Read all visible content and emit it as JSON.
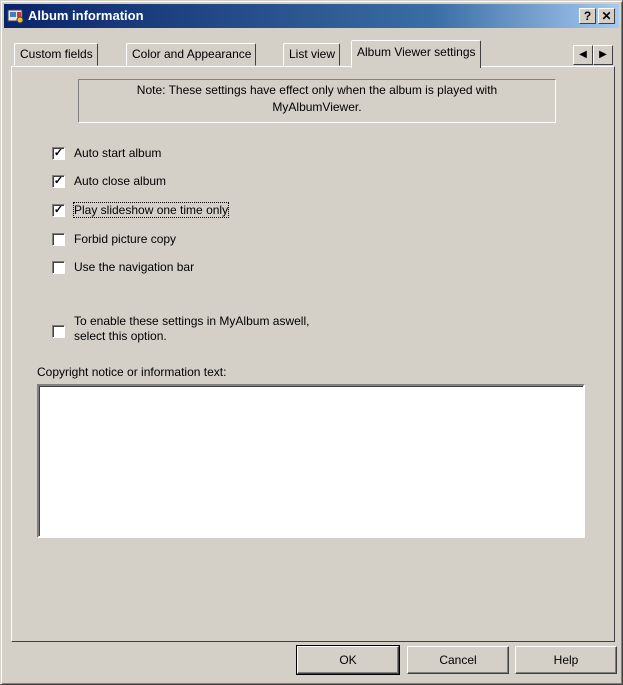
{
  "window": {
    "title": "Album information",
    "help_btn": "?",
    "close_btn": "✕"
  },
  "tabs": [
    {
      "label": "Custom fields"
    },
    {
      "label": "Color and Appearance"
    },
    {
      "label": "List view"
    },
    {
      "label": "Album Viewer settings"
    }
  ],
  "tab_scroll": {
    "left": "◀",
    "right": "▶"
  },
  "note": {
    "line1": "Note: These settings have effect only when the album is played with",
    "line2": "MyAlbumViewer."
  },
  "options": [
    {
      "label": "Auto start album",
      "checked": true,
      "check_mark": "✓"
    },
    {
      "label": "Auto close album",
      "checked": true,
      "check_mark": "✓"
    },
    {
      "label": "Play slideshow one time only",
      "checked": true,
      "check_mark": "✓"
    },
    {
      "label": "Forbid picture copy",
      "checked": false,
      "check_mark": ""
    },
    {
      "label": "Use the navigation bar",
      "checked": false,
      "check_mark": ""
    }
  ],
  "enable_option": {
    "line1": "To enable these settings in MyAlbum aswell,",
    "line2": "select this option.",
    "checked": false
  },
  "copyright": {
    "label": "Copyright notice or information text:",
    "value": ""
  },
  "buttons": {
    "ok": "OK",
    "cancel": "Cancel",
    "help": "Help"
  }
}
